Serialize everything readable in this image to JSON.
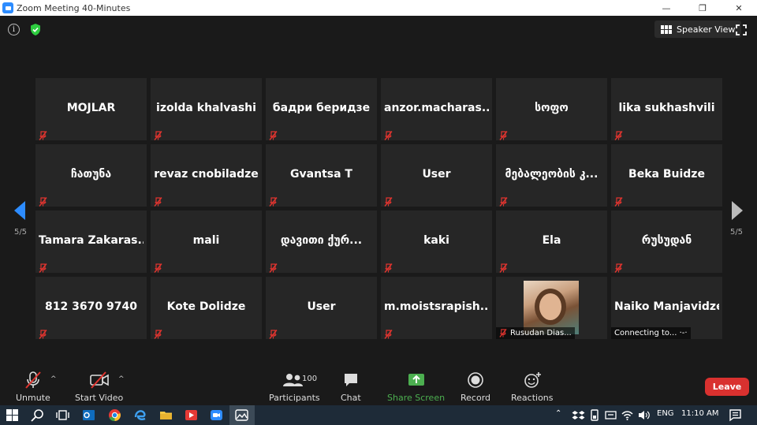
{
  "window": {
    "title": "Zoom Meeting 40-Minutes",
    "controls": [
      "—",
      "❐",
      "✕"
    ]
  },
  "topbar": {
    "info_glyph": "i",
    "speaker_view_label": "Speaker View",
    "shield_color": "#2ecc40"
  },
  "gallery": {
    "tiles": [
      {
        "name": "MOJLAR"
      },
      {
        "name": "izolda khalvashi"
      },
      {
        "name": "бадри беридзе"
      },
      {
        "name": "anzor.macharas..."
      },
      {
        "name": "სოფო"
      },
      {
        "name": "lika sukhashvili"
      },
      {
        "name": "ჩათუნა"
      },
      {
        "name": "revaz cnobiladze"
      },
      {
        "name": "Gvantsa T"
      },
      {
        "name": "User"
      },
      {
        "name": "მებალეობის  კ..."
      },
      {
        "name": "Beka Buidze"
      },
      {
        "name": "Tamara  Zakaras..."
      },
      {
        "name": "mali"
      },
      {
        "name": "დავითი  ქურ..."
      },
      {
        "name": "kaki"
      },
      {
        "name": "Ela"
      },
      {
        "name": "რუსუდან"
      },
      {
        "name": "812 3670 9740"
      },
      {
        "name": "Kote Dolidze"
      },
      {
        "name": "User"
      },
      {
        "name": "m.moistsrapish..."
      },
      {
        "name": "Rusudan Dias...",
        "video": true
      },
      {
        "name": "Naiko Manjavidze",
        "status": "Connecting to... ·-·"
      }
    ],
    "page_left": "5/5",
    "page_right": "5/5"
  },
  "toolbar": {
    "unmute_label": "Unmute",
    "start_video_label": "Start Video",
    "participants_label": "Participants",
    "participants_count": "100",
    "chat_label": "Chat",
    "share_screen_label": "Share Screen",
    "record_label": "Record",
    "reactions_label": "Reactions",
    "leave_label": "Leave",
    "caret": "^",
    "share_color": "#4caf50",
    "leave_color": "#d9312f"
  },
  "taskbar": {
    "language": "ENG",
    "time": "11:10 AM"
  }
}
